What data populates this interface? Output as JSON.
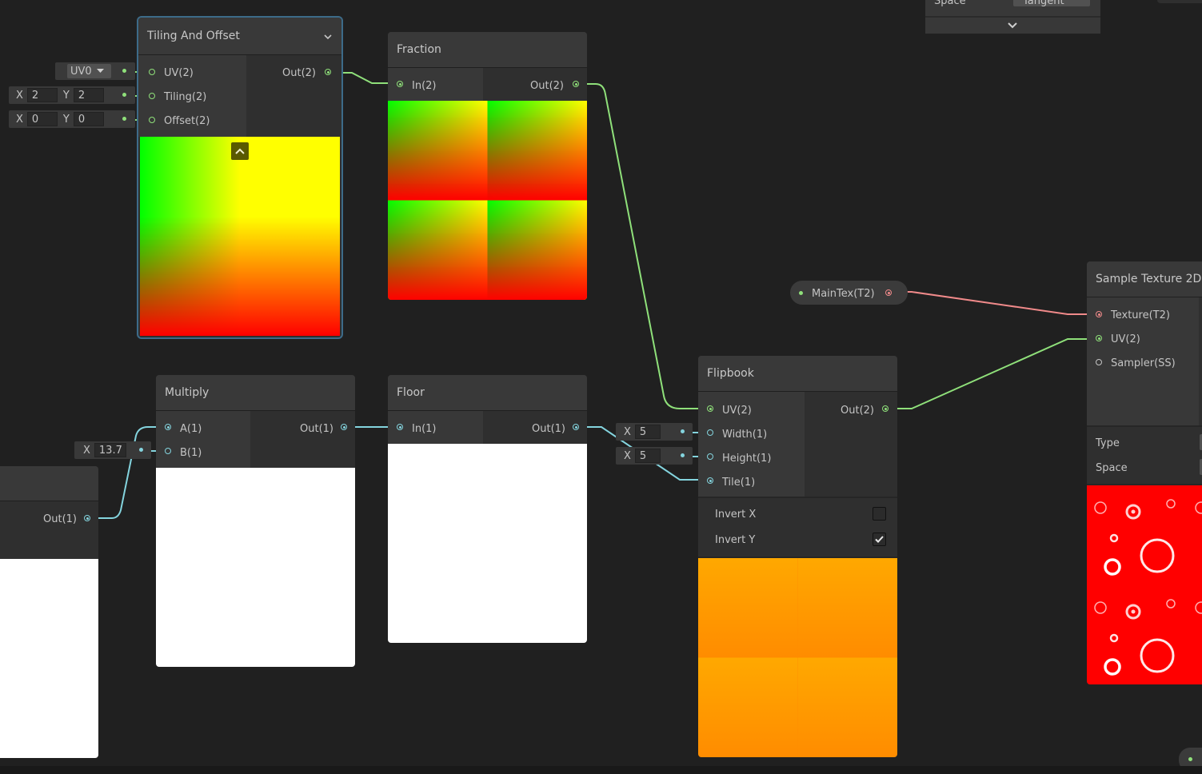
{
  "top_panel": {
    "space_label": "Space",
    "space_value": "Tangent"
  },
  "tiling_node": {
    "title": "Tiling And Offset",
    "inputs": [
      "UV(2)",
      "Tiling(2)",
      "Offset(2)"
    ],
    "output": "Out(2)",
    "uv_channel": "UV0",
    "tiling": {
      "x_label": "X",
      "x": "2",
      "y_label": "Y",
      "y": "2"
    },
    "offset": {
      "x_label": "X",
      "x": "0",
      "y_label": "Y",
      "y": "0"
    }
  },
  "fraction_node": {
    "title": "Fraction",
    "input": "In(2)",
    "output": "Out(2)"
  },
  "multiply_node": {
    "title": "Multiply",
    "inputs": [
      "A(1)",
      "B(1)"
    ],
    "output": "Out(1)",
    "b_value": {
      "label": "X",
      "value": "13.7"
    }
  },
  "floor_node": {
    "title": "Floor",
    "input": "In(1)",
    "output": "Out(1)"
  },
  "left_node": {
    "output": "Out(1)"
  },
  "maintex_property": {
    "label": "MainTex(T2)"
  },
  "flipbook_node": {
    "title": "Flipbook",
    "inputs": [
      "UV(2)",
      "Width(1)",
      "Height(1)",
      "Tile(1)"
    ],
    "output": "Out(2)",
    "width_value": {
      "label": "X",
      "value": "5"
    },
    "height_value": {
      "label": "X",
      "value": "5"
    },
    "options": [
      {
        "label": "Invert X",
        "checked": false
      },
      {
        "label": "Invert Y",
        "checked": true
      }
    ]
  },
  "sample_texture_node": {
    "title": "Sample Texture 2D",
    "inputs": [
      "Texture(T2)",
      "UV(2)",
      "Sampler(SS)"
    ],
    "settings": [
      "Type",
      "Space"
    ]
  },
  "colors": {
    "vector2": "#8fe07a",
    "vector1": "#84d4de",
    "texture": "#f08a8a",
    "selection": "#3d6b89"
  }
}
